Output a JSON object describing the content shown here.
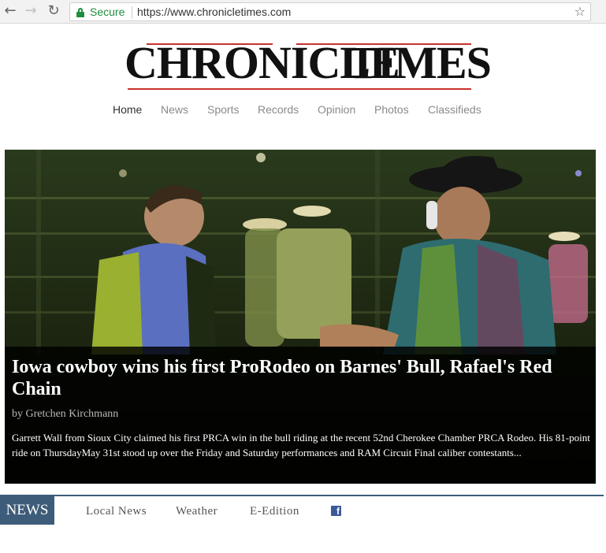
{
  "browser": {
    "back_icon": "arrow-left-icon",
    "back_glyph": "←",
    "forward_icon": "arrow-right-icon",
    "forward_glyph": "→",
    "reload_icon": "reload-icon",
    "reload_glyph": "↻",
    "lock_icon": "lock-icon",
    "secure_label": "Secure",
    "url": "https://www.chronicletimes.com",
    "bookmark_icon": "star-icon",
    "bookmark_glyph": "☆",
    "secure_color": "#1e8e3e"
  },
  "site": {
    "logo_text": "CHRONICLE TIMES",
    "logo_word_1": "CHRONICLE",
    "logo_word_2": "TIMES",
    "accent_color": "#c8322b"
  },
  "nav": {
    "items": [
      {
        "label": "Home",
        "active": true
      },
      {
        "label": "News",
        "active": false
      },
      {
        "label": "Sports",
        "active": false
      },
      {
        "label": "Records",
        "active": false
      },
      {
        "label": "Opinion",
        "active": false
      },
      {
        "label": "Photos",
        "active": false
      },
      {
        "label": "Classifieds",
        "active": false
      }
    ]
  },
  "hero": {
    "headline": "Iowa cowboy wins his first ProRodeo on Barnes' Bull, Rafael's Red Chain",
    "byline": "by Gretchen Kirchmann",
    "teaser": "Garrett Wall from Sioux City claimed his first PRCA win in the bull riding at the recent 52nd Cherokee Chamber PRCA Rodeo. His 81-point ride on ThursdayMay 31st stood up over the Friday and Saturday performances and RAM Circuit Final caliber contestants..."
  },
  "news_bar": {
    "badge": "NEWS",
    "badge_color": "#3d5c79",
    "links": [
      "Local News",
      "Weather",
      "E-Edition"
    ],
    "facebook_icon": "facebook-icon",
    "facebook_glyph": "f"
  }
}
